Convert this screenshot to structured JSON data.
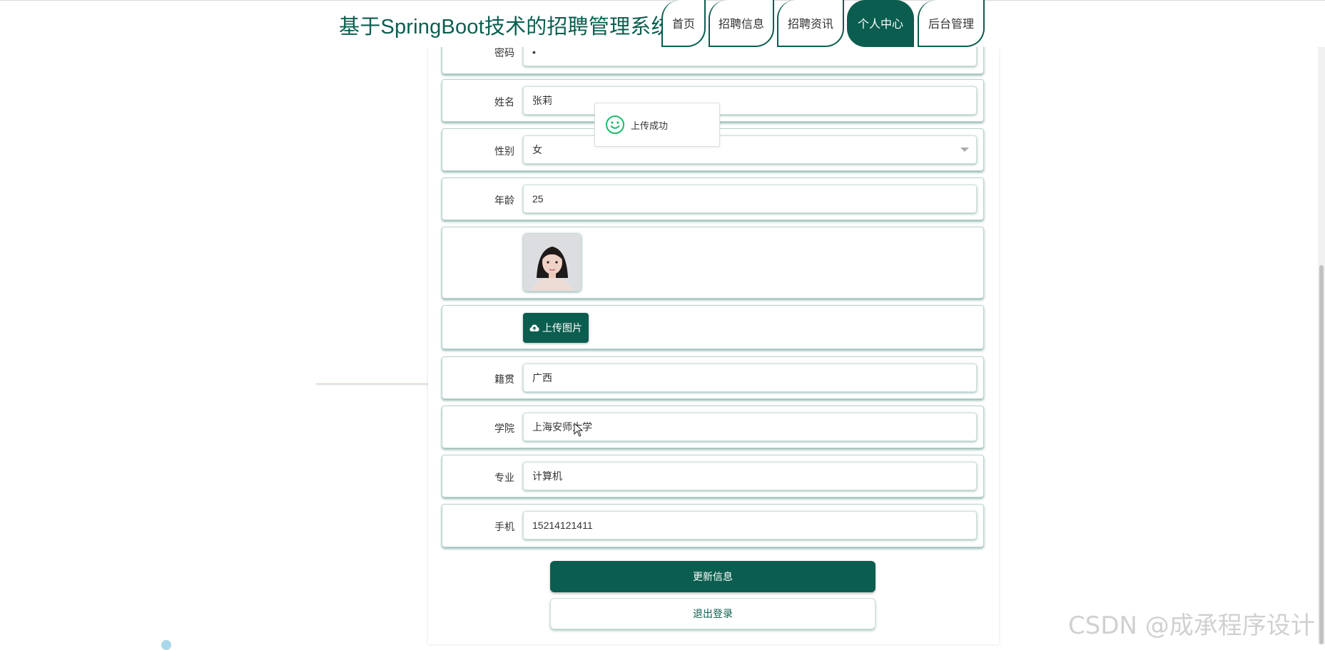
{
  "header": {
    "title": "基于SpringBoot技术的招聘管理系统",
    "nav": [
      {
        "label": "首页",
        "active": false
      },
      {
        "label": "招聘信息",
        "active": false
      },
      {
        "label": "招聘资讯",
        "active": false
      },
      {
        "label": "个人中心",
        "active": true
      },
      {
        "label": "后台管理",
        "active": false
      }
    ]
  },
  "form": {
    "password": {
      "label": "密码",
      "value": "•"
    },
    "name": {
      "label": "姓名",
      "value": "张莉"
    },
    "gender": {
      "label": "性别",
      "value": "女"
    },
    "age": {
      "label": "年龄",
      "value": "25"
    },
    "photo": {
      "alt": "avatar"
    },
    "upload_label": "上传图片",
    "hometown": {
      "label": "籍贯",
      "value": "广西"
    },
    "college": {
      "label": "学院",
      "value": "上海安师大学"
    },
    "major": {
      "label": "专业",
      "value": "计算机"
    },
    "phone": {
      "label": "手机",
      "value": "15214121411"
    }
  },
  "actions": {
    "update": "更新信息",
    "logout": "退出登录"
  },
  "toast": {
    "message": "上传成功",
    "icon": "smile-icon"
  },
  "watermark": "CSDN @成承程序设计",
  "colors": {
    "brand": "#0b5e4f",
    "success_icon": "#19be6b"
  }
}
